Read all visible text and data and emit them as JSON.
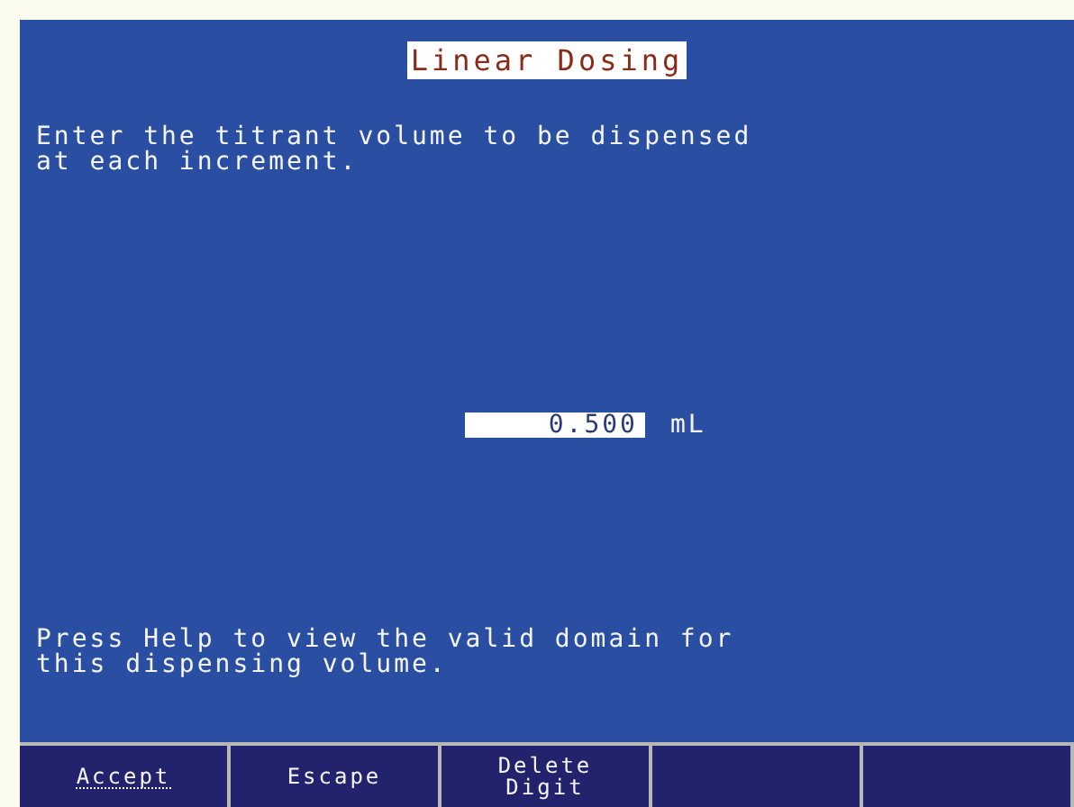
{
  "title": "Linear Dosing",
  "prompt": "Enter the titrant volume to be dispensed\nat each increment.",
  "entry": {
    "value": "0.500",
    "unit": "mL"
  },
  "help": "Press Help to view the valid domain for\nthis dispensing volume.",
  "softkeys": [
    {
      "label": "Accept",
      "selected": true
    },
    {
      "label": "Escape",
      "selected": false
    },
    {
      "label": "Delete\nDigit",
      "selected": false
    }
  ]
}
